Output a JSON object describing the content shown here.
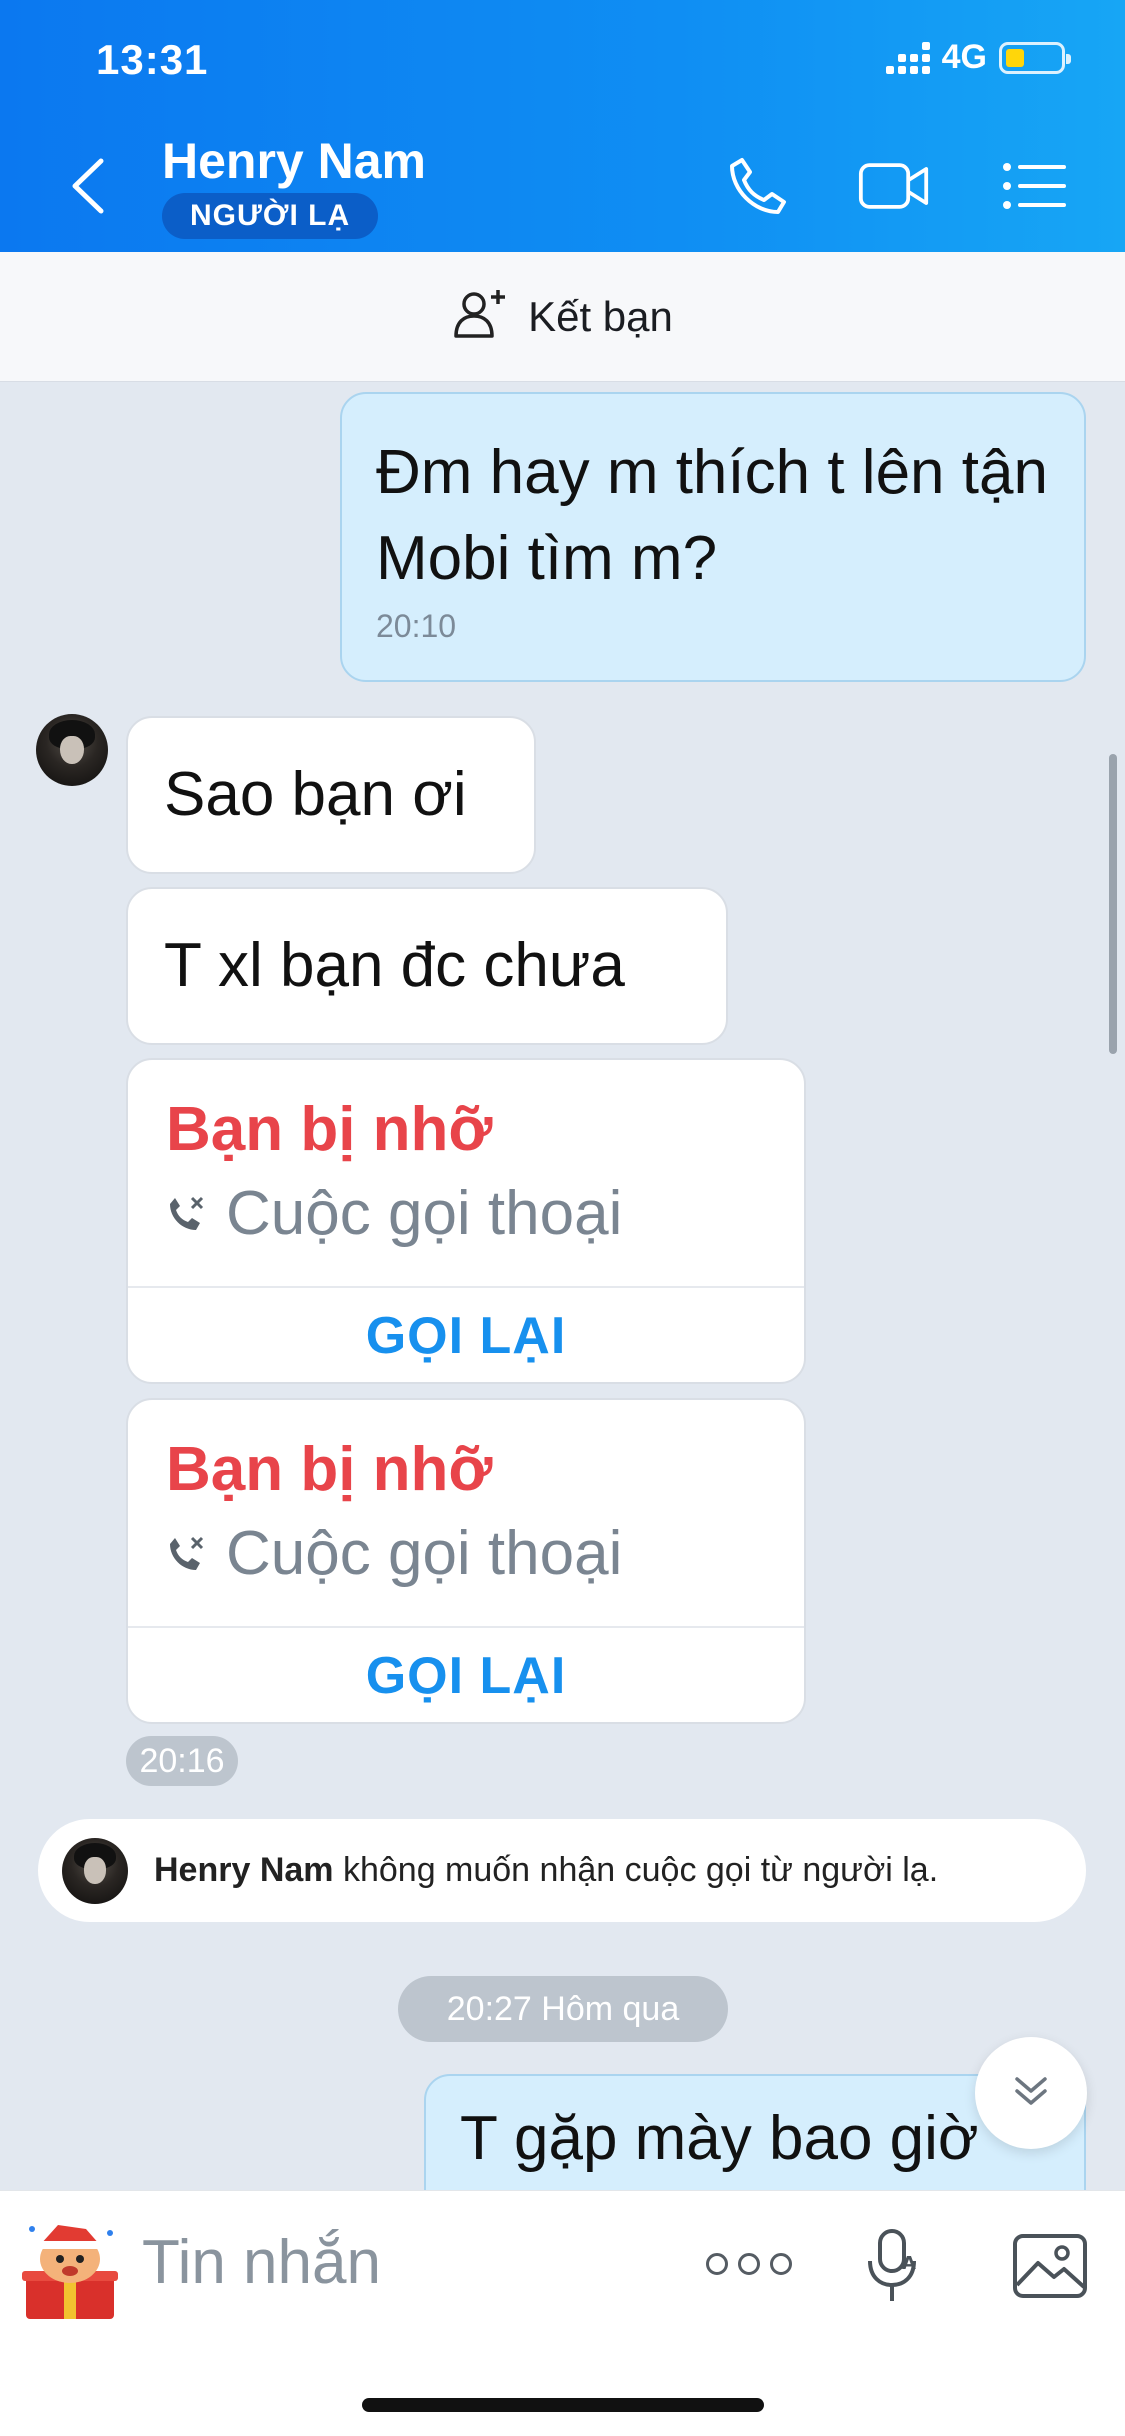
{
  "status_bar": {
    "time": "13:31",
    "network": "4G"
  },
  "header": {
    "contact_name": "Henry Nam",
    "badge": "NGƯỜI LẠ",
    "icons": [
      "back-arrow-icon",
      "phone-icon",
      "video-call-icon",
      "menu-list-icon"
    ]
  },
  "friend_bar": {
    "label": "Kết bạn"
  },
  "messages": {
    "m1": {
      "text": "Đm hay m thích t lên tận Mobi tìm m?",
      "time": "20:10"
    },
    "m2": {
      "text": "Sao bạn ơi"
    },
    "m3": {
      "text": "T xl bạn đc chưa"
    },
    "call1": {
      "title": "Bạn bị nhỡ",
      "subtitle": "Cuộc gọi thoại",
      "action": "GỌI LẠI"
    },
    "call2": {
      "title": "Bạn bị nhỡ",
      "subtitle": "Cuộc gọi thoại",
      "action": "GỌI LẠI"
    },
    "group_time": "20:16",
    "notice_name": "Henry Nam",
    "notice_text": " không muốn nhận cuộc gọi từ người lạ.",
    "day_separator": "20:27 Hôm qua",
    "m4": {
      "text": "T gặp mày bao giờ"
    }
  },
  "input_bar": {
    "placeholder": "Tin nhắn"
  },
  "colors": {
    "header_blue": "#0b78f0",
    "missed_red": "#e8444a",
    "call_back_blue": "#1790ee",
    "my_bubble": "#d5eefd"
  }
}
